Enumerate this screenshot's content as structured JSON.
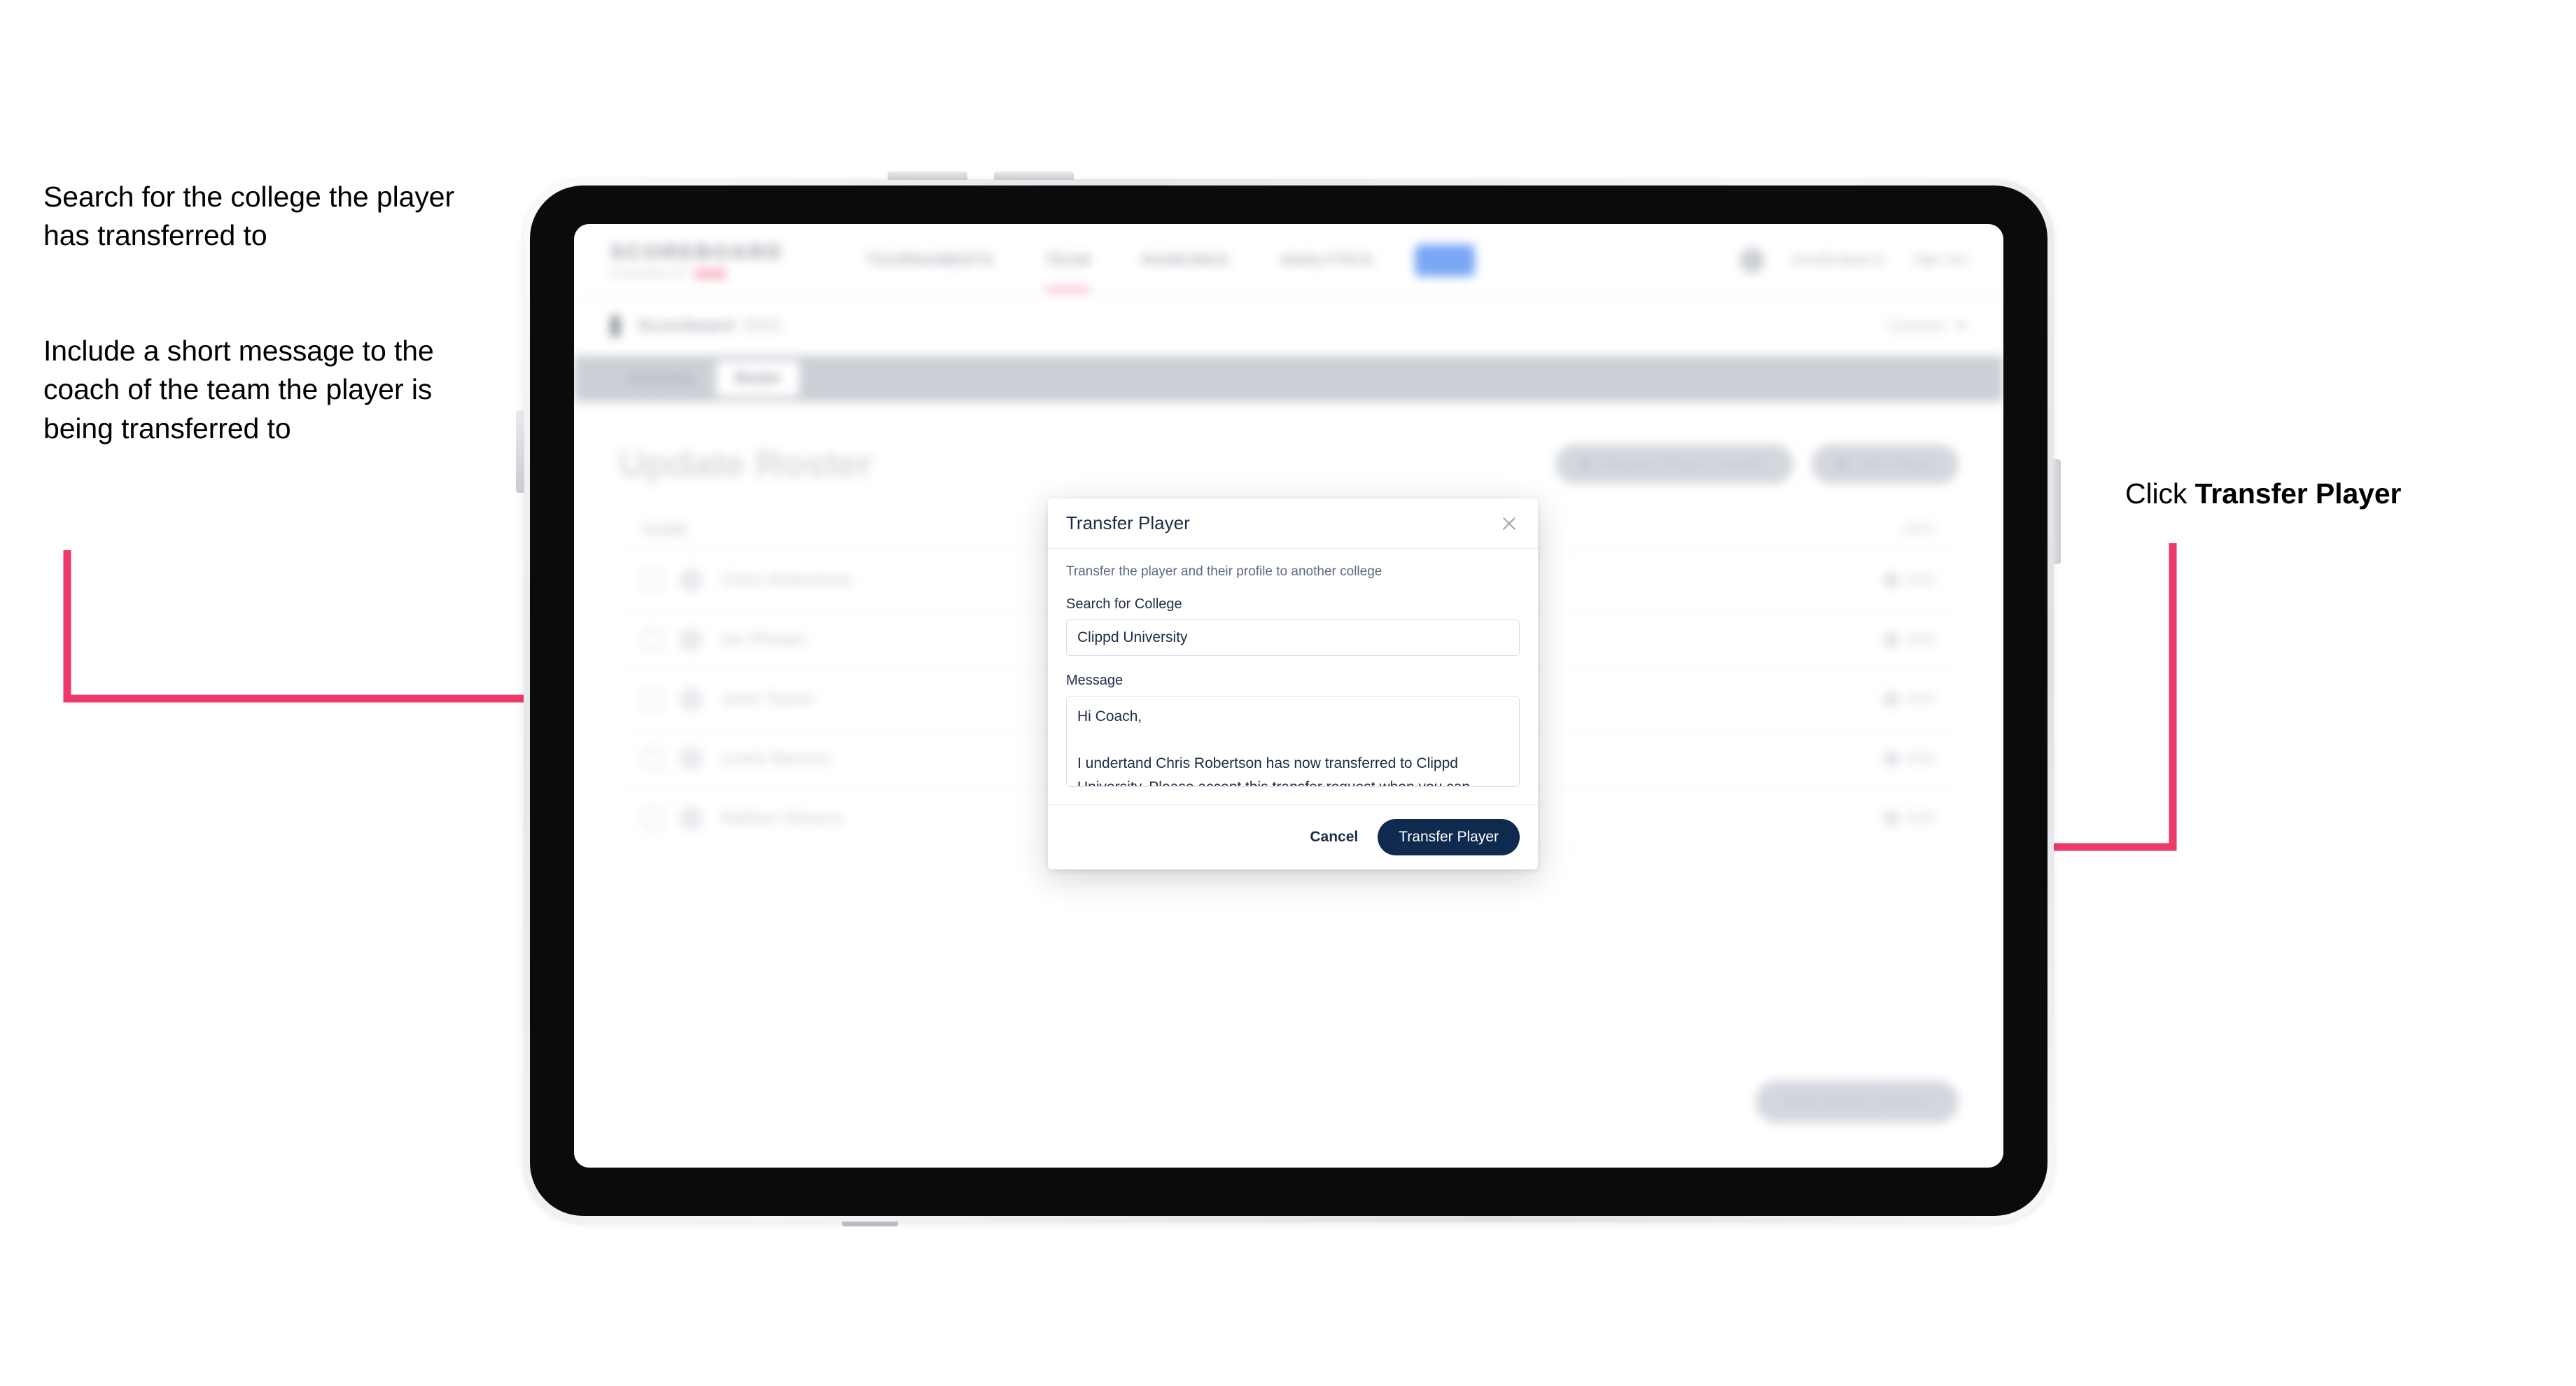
{
  "annotations": {
    "left_1": "Search for the college the player has transferred to",
    "left_2": "Include a short message to the coach of the team the player is being transferred to",
    "right_prefix": "Click ",
    "right_emphasis": "Transfer Player"
  },
  "colors": {
    "arrow": "#EE3A6B",
    "primary_button": "#0E2A4E",
    "modal_title": "#1D2B44",
    "tab_bar": "#CCD0D6"
  },
  "app": {
    "brand": {
      "name": "SCOREBOARD",
      "sub": "POWERED BY",
      "badge": ""
    },
    "nav": {
      "links": [
        {
          "label": "TOURNAMENTS",
          "active": false
        },
        {
          "label": "TEAM",
          "active": true
        },
        {
          "label": "RANKINGS",
          "active": false
        },
        {
          "label": "ANALYTICS",
          "active": false
        }
      ],
      "pill_label": "",
      "user_email": "jane@clippd.io",
      "sign_out": "Sign Out"
    },
    "breadcrumb": {
      "title": "Scoreboard",
      "subtitle": "2024",
      "right_label": "Connect",
      "right_icon": "chevron-down-icon"
    },
    "tabs": [
      {
        "label": "Overview",
        "active": false
      },
      {
        "label": "Roster",
        "active": true
      }
    ],
    "page": {
      "title": "Update Roster",
      "actions": [
        {
          "label": "Request Player Transfer",
          "icon": "transfer-icon"
        },
        {
          "label": "Add Player",
          "icon": "plus-icon"
        }
      ],
      "save_label": "Save Roster Updates"
    },
    "roster": {
      "header": "NAME",
      "header_right": "EDIT",
      "rows": [
        {
          "name": "Chris Robertson",
          "edit": "Edit"
        },
        {
          "name": "Ian Phelps",
          "edit": "Edit"
        },
        {
          "name": "John Taylor",
          "edit": "Edit"
        },
        {
          "name": "Lewis Barnes",
          "edit": "Edit"
        },
        {
          "name": "Nathan Simons",
          "edit": "Edit"
        }
      ]
    }
  },
  "modal": {
    "title": "Transfer Player",
    "close_icon": "close-icon",
    "description": "Transfer the player and their profile to another college",
    "fields": {
      "college_label": "Search for College",
      "college_value": "Clippd University",
      "college_placeholder": "Search for College",
      "message_label": "Message",
      "message_value": "Hi Coach,\n\nI undertand Chris Robertson has now transferred to Clippd University. Please accept this transfer request when you can.",
      "message_placeholder": "Message"
    },
    "cancel_label": "Cancel",
    "submit_label": "Transfer Player"
  }
}
